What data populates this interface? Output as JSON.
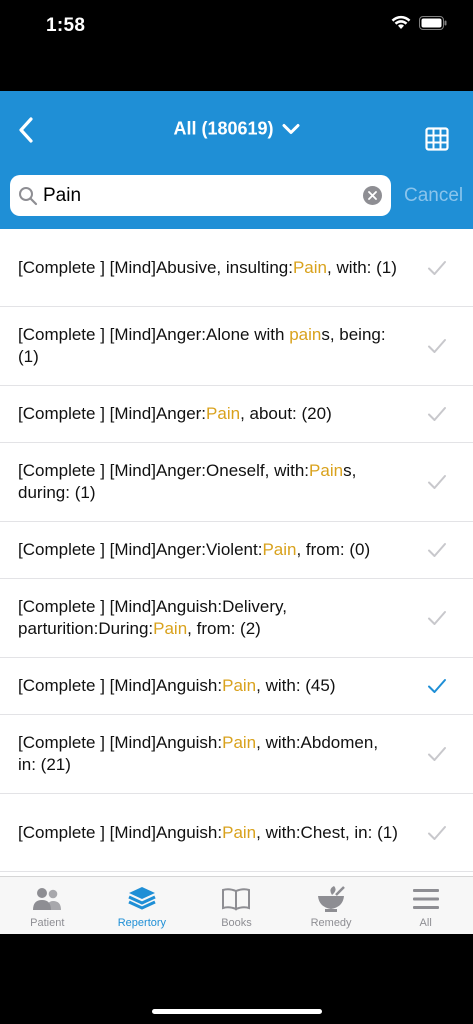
{
  "status": {
    "time": "1:58"
  },
  "nav": {
    "title": "All (180619)"
  },
  "search": {
    "value": "Pain",
    "cancel_label": "Cancel"
  },
  "results": [
    {
      "parts": [
        "[Complete ] [Mind]Abusive, insulting:",
        "Pain",
        ", with: (1)"
      ],
      "checked": false
    },
    {
      "parts": [
        "[Complete ] [Mind]Anger:Alone with ",
        "pain",
        "s, being: (1)"
      ],
      "checked": false
    },
    {
      "parts": [
        "[Complete ] [Mind]Anger:",
        "Pain",
        ", about: (20)"
      ],
      "checked": false
    },
    {
      "parts": [
        "[Complete ] [Mind]Anger:Oneself, with:",
        "Pain",
        "s, during: (1)"
      ],
      "checked": false
    },
    {
      "parts": [
        "[Complete ] [Mind]Anger:Violent:",
        "Pain",
        ", from: (0)"
      ],
      "checked": false
    },
    {
      "parts": [
        "[Complete ] [Mind]Anguish:Delivery, parturition:During:",
        "Pain",
        ", from: (2)"
      ],
      "checked": false
    },
    {
      "parts": [
        "[Complete ] [Mind]Anguish:",
        "Pain",
        ", with: (45)"
      ],
      "checked": true
    },
    {
      "parts": [
        "[Complete ] [Mind]Anguish:",
        "Pain",
        ", with:Abdomen, in: (21)"
      ],
      "checked": false
    },
    {
      "parts": [
        "[Complete ] [Mind]Anguish:",
        "Pain",
        ", with:Chest, in: (1)"
      ],
      "checked": false
    }
  ],
  "tabs": [
    {
      "label": "Patient",
      "icon": "patient-icon",
      "active": false
    },
    {
      "label": "Repertory",
      "icon": "repertory-icon",
      "active": true
    },
    {
      "label": "Books",
      "icon": "books-icon",
      "active": false
    },
    {
      "label": "Remedy",
      "icon": "remedy-icon",
      "active": false
    },
    {
      "label": "All",
      "icon": "menu-icon",
      "active": false
    }
  ],
  "colors": {
    "accent": "#1f8fd6",
    "highlight": "#d9a21d",
    "check_inactive": "#c8c8cc",
    "check_active": "#1f8fd6"
  }
}
